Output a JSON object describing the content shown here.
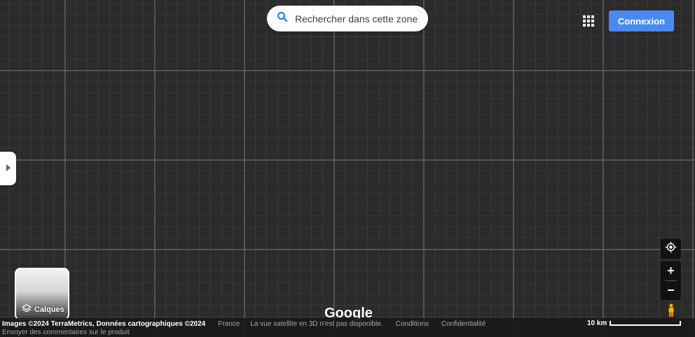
{
  "search": {
    "label": "Rechercher dans cette zone",
    "icon": "search-icon"
  },
  "header": {
    "apps_icon": "apps-grid-icon",
    "signin_label": "Connexion"
  },
  "side_panel": {
    "icon": "chevron-right-icon"
  },
  "layers": {
    "label": "Calques",
    "icon": "layers-icon"
  },
  "map_controls": {
    "locate_icon": "my-location-icon",
    "zoom_in": "+",
    "zoom_out": "−",
    "pegman_icon": "pegman-icon"
  },
  "logo": {
    "text": "Google"
  },
  "footer": {
    "attribution": "Images ©2024 TerraMetrics, Données cartographiques ©2024",
    "country": "France",
    "message": "La vue satellite en 3D n'est pas disponible.",
    "terms": "Conditions",
    "privacy": "Confidentialité",
    "feedback": "Envoyer des commentaires sur le produit",
    "scale": "10 km"
  },
  "colors": {
    "accent": "#4a89f3",
    "map_bg": "#2b2b2b",
    "search_icon": "#1a73e8",
    "pegman": "#f5b400"
  }
}
